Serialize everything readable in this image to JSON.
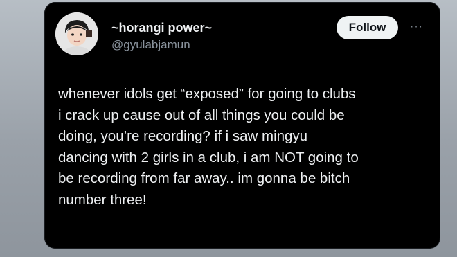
{
  "author": {
    "display_name": "~horangi power~",
    "handle": "@gyulabjamun",
    "avatar_icon": "profile-photo-child"
  },
  "actions": {
    "follow_label": "Follow",
    "more_icon": "more-horizontal-icon",
    "more_glyph": "···"
  },
  "tweet": {
    "lines": [
      "whenever idols get “exposed” for going to clubs",
      "i crack up cause out of all things you could be",
      "doing, you’re recording? if i saw mingyu",
      "dancing with 2 girls in a club, i am NOT going to",
      "be recording from far away.. im gonna be bitch",
      "number three!"
    ]
  },
  "colors": {
    "card_background": "#000000",
    "primary_text": "#eef0f2",
    "secondary_text": "#8b949e",
    "follow_button_bg": "#eff3f4",
    "follow_button_text": "#0f1419"
  }
}
